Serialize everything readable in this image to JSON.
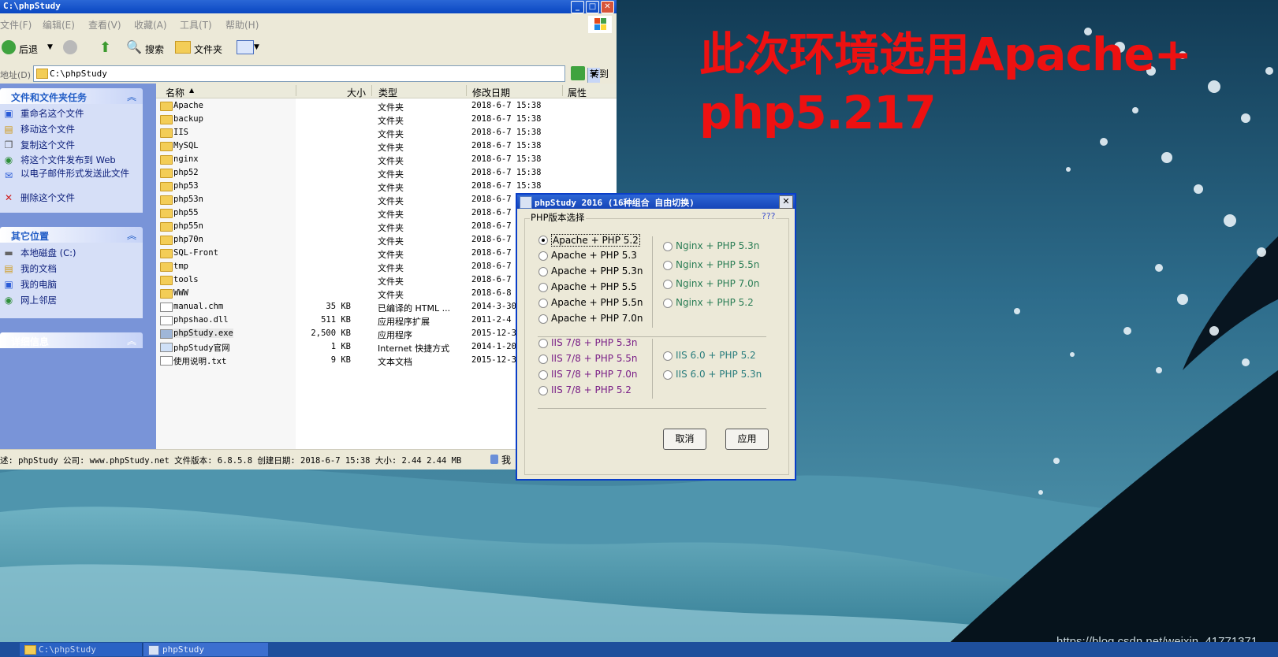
{
  "headline": {
    "line1": "此次环境选用Apache+",
    "line2": "php5.217"
  },
  "watermark": "https://blog.csdn.net/weixin_41771371",
  "explorer": {
    "title": "C:\\phpStudy",
    "menu": [
      "文件(F)",
      "编辑(E)",
      "查看(V)",
      "收藏(A)",
      "工具(T)",
      "帮助(H)"
    ],
    "toolbar": {
      "back": "后退",
      "search": "搜索",
      "folders": "文件夹"
    },
    "address": {
      "label": "地址(D)",
      "value": "C:\\phpStudy",
      "go": "转到"
    },
    "side": {
      "tasks_title": "文件和文件夹任务",
      "tasks": [
        "重命名这个文件",
        "移动这个文件",
        "复制这个文件",
        "将这个文件发布到 Web",
        "以电子邮件形式发送此文件",
        "删除这个文件"
      ],
      "places_title": "其它位置",
      "places": [
        "本地磁盘 (C:)",
        "我的文档",
        "我的电脑",
        "网上邻居"
      ],
      "details_title": "详细信息"
    },
    "columns": [
      "名称",
      "大小",
      "类型",
      "修改日期",
      "属性"
    ],
    "files": [
      {
        "name": "Apache",
        "size": "",
        "type": "文件夹",
        "date": "2018-6-7 15:38"
      },
      {
        "name": "backup",
        "size": "",
        "type": "文件夹",
        "date": "2018-6-7 15:38"
      },
      {
        "name": "IIS",
        "size": "",
        "type": "文件夹",
        "date": "2018-6-7 15:38"
      },
      {
        "name": "MySQL",
        "size": "",
        "type": "文件夹",
        "date": "2018-6-7 15:38"
      },
      {
        "name": "nginx",
        "size": "",
        "type": "文件夹",
        "date": "2018-6-7 15:38"
      },
      {
        "name": "php52",
        "size": "",
        "type": "文件夹",
        "date": "2018-6-7 15:38"
      },
      {
        "name": "php53",
        "size": "",
        "type": "文件夹",
        "date": "2018-6-7 15:38"
      },
      {
        "name": "php53n",
        "size": "",
        "type": "文件夹",
        "date": "2018-6-7"
      },
      {
        "name": "php55",
        "size": "",
        "type": "文件夹",
        "date": "2018-6-7"
      },
      {
        "name": "php55n",
        "size": "",
        "type": "文件夹",
        "date": "2018-6-7"
      },
      {
        "name": "php70n",
        "size": "",
        "type": "文件夹",
        "date": "2018-6-7"
      },
      {
        "name": "SQL-Front",
        "size": "",
        "type": "文件夹",
        "date": "2018-6-7"
      },
      {
        "name": "tmp",
        "size": "",
        "type": "文件夹",
        "date": "2018-6-7"
      },
      {
        "name": "tools",
        "size": "",
        "type": "文件夹",
        "date": "2018-6-7"
      },
      {
        "name": "WWW",
        "size": "",
        "type": "文件夹",
        "date": "2018-6-8"
      },
      {
        "name": "manual.chm",
        "size": "35 KB",
        "type": "已编译的 HTML ...",
        "date": "2014-3-30"
      },
      {
        "name": "phpshao.dll",
        "size": "511 KB",
        "type": "应用程序扩展",
        "date": "2011-2-4"
      },
      {
        "name": "phpStudy.exe",
        "size": "2,500 KB",
        "type": "应用程序",
        "date": "2015-12-3"
      },
      {
        "name": "phpStudy官网",
        "size": "1 KB",
        "type": "Internet 快捷方式",
        "date": "2014-1-20"
      },
      {
        "name": "使用说明.txt",
        "size": "9 KB",
        "type": "文本文档",
        "date": "2015-12-3"
      }
    ],
    "status": "述: phpStudy 公司: www.phpStudy.net 文件版本: 6.8.5.8 创建日期: 2018-6-7 15:38 大小: 2.44 2.44 MB",
    "status_zone": "我"
  },
  "dialog": {
    "title": "phpStudy 2016  (16种组合 自由切换)",
    "group_label": "PHP版本选择",
    "help": "???",
    "apache": [
      "Apache + PHP 5.2",
      "Apache + PHP 5.3",
      "Apache + PHP 5.3n",
      "Apache + PHP 5.5",
      "Apache + PHP 5.5n",
      "Apache + PHP 7.0n"
    ],
    "nginx": [
      "Nginx + PHP 5.3n",
      "Nginx + PHP 5.5n",
      "Nginx + PHP 7.0n",
      "Nginx + PHP 5.2"
    ],
    "iis78": [
      "IIS 7/8 + PHP 5.3n",
      "IIS 7/8 + PHP 5.5n",
      "IIS 7/8 + PHP 7.0n",
      "IIS 7/8 + PHP 5.2"
    ],
    "iis6": [
      "IIS 6.0 + PHP 5.2",
      "IIS 6.0 + PHP 5.3n"
    ],
    "selected": "Apache + PHP 5.2",
    "cancel": "取消",
    "apply": "应用"
  },
  "taskbar": {
    "items": [
      "C:\\phpStudy",
      "phpStudy"
    ]
  }
}
